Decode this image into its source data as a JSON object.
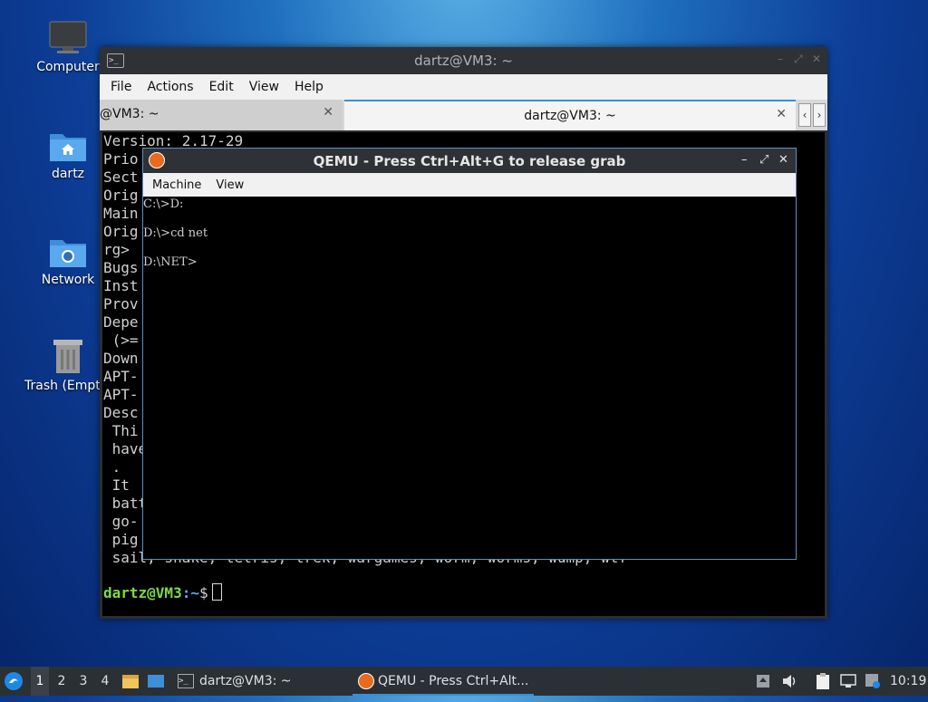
{
  "desktop": {
    "icons": [
      {
        "label": "Computer",
        "icon": "computer-icon"
      },
      {
        "label": "dartz",
        "icon": "home-folder-icon"
      },
      {
        "label": "Network",
        "icon": "network-folder-icon"
      },
      {
        "label": "Trash (Empty)",
        "icon": "trash-icon"
      }
    ]
  },
  "terminal": {
    "title": "dartz@VM3: ~",
    "menu": [
      "File",
      "Actions",
      "Edit",
      "View",
      "Help"
    ],
    "tabs": [
      {
        "label": "@VM3: ~"
      },
      {
        "label": "dartz@VM3: ~"
      }
    ],
    "lines": [
      "Version: 2.17-29",
      "Prio",
      "Sect",
      "Orig",
      "Main",
      "Orig",
      "rg>",
      "Bugs",
      "Inst",
      "Prov",
      "Depe",
      " (>=",
      "Down",
      "APT-",
      "APT-",
      "Desc",
      " Thi",
      " have",
      " .",
      " It ",
      " batt",
      " go-",
      " pig",
      " sail, snake, tetris, trek, wargames, worm, worms, wump, wtf"
    ],
    "prompt_user": "dartz@VM3",
    "prompt_path": ":~",
    "prompt_symbol": "$"
  },
  "qemu": {
    "title": "QEMU - Press Ctrl+Alt+G to release grab",
    "menu": [
      "Machine",
      "View"
    ],
    "screen_lines": [
      "C:\\>D:",
      "",
      "D:\\>cd net",
      "",
      "D:\\NET>"
    ]
  },
  "taskbar": {
    "workspaces": [
      "1",
      "2",
      "3",
      "4"
    ],
    "active_workspace": "1",
    "tasks": [
      {
        "label": "dartz@VM3: ~",
        "icon": "terminal-icon"
      },
      {
        "label": "QEMU - Press Ctrl+Alt...",
        "icon": "qemu-icon"
      }
    ],
    "clock": "10:19"
  },
  "colors": {
    "accent": "#3a8fd6",
    "prompt_green": "#7cdc44",
    "prompt_blue": "#6aa2ff"
  }
}
